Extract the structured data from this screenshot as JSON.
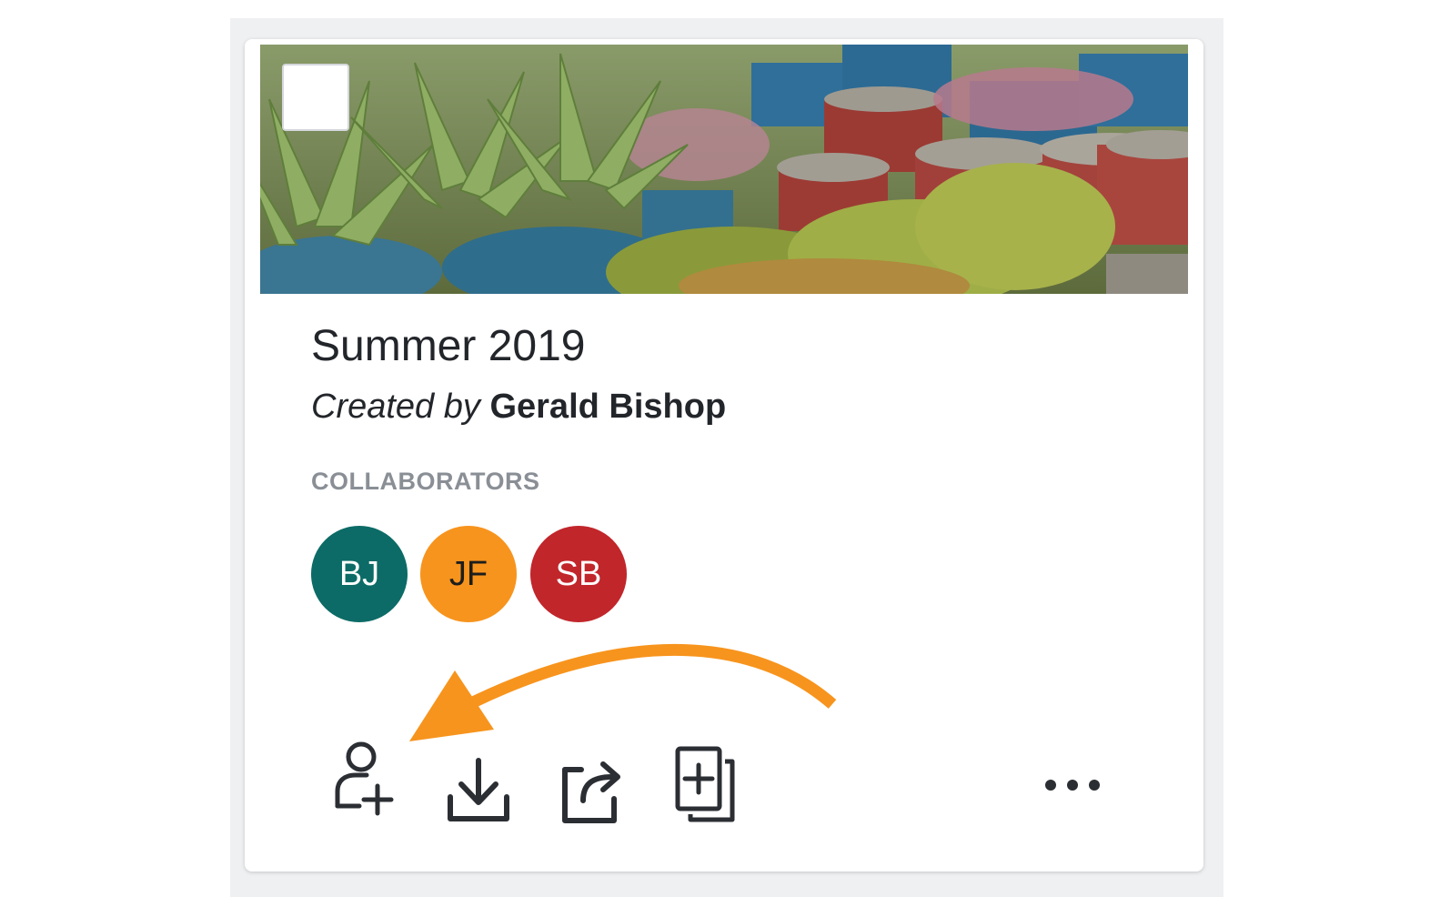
{
  "card": {
    "title": "Summer 2019",
    "created_by_prefix": "Created by",
    "created_by_name": "Gerald Bishop",
    "collaborators_label": "COLLABORATORS",
    "collaborators": [
      {
        "initials": "BJ",
        "color": "#0c6b66",
        "text_color": "#ffffff"
      },
      {
        "initials": "JF",
        "color": "#f7941d",
        "text_color": "#1d1d1d"
      },
      {
        "initials": "SB",
        "color": "#c1262b",
        "text_color": "#ffffff"
      }
    ],
    "actions": [
      {
        "name": "add-collaborator-button",
        "icon": "add-person-icon"
      },
      {
        "name": "download-button",
        "icon": "download-icon"
      },
      {
        "name": "share-button",
        "icon": "share-icon"
      },
      {
        "name": "duplicate-button",
        "icon": "duplicate-icon"
      },
      {
        "name": "more-button",
        "icon": "more-horizontal-icon"
      }
    ]
  },
  "annotation": {
    "arrow_color": "#f7941d",
    "points_to": "add-collaborator-button"
  }
}
